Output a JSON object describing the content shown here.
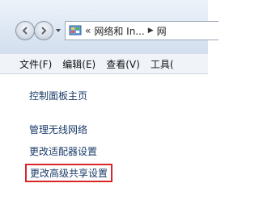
{
  "navigation": {
    "back_icon": "back-arrow-icon",
    "forward_icon": "forward-arrow-icon",
    "history_icon": "chevron-down-icon"
  },
  "address_bar": {
    "icon": "control-panel-icon",
    "overflow": "«",
    "path": [
      "网络和 In...",
      "网"
    ]
  },
  "menu": {
    "items": [
      "文件(F)",
      "编辑(E)",
      "查看(V)",
      "工具("
    ]
  },
  "task_pane": {
    "home": "控制面板主页",
    "links": [
      "管理无线网络",
      "更改适配器设置",
      "更改高级共享设置"
    ]
  },
  "colors": {
    "highlight_box": "#d8262c",
    "link_text": "#1b3b69"
  }
}
